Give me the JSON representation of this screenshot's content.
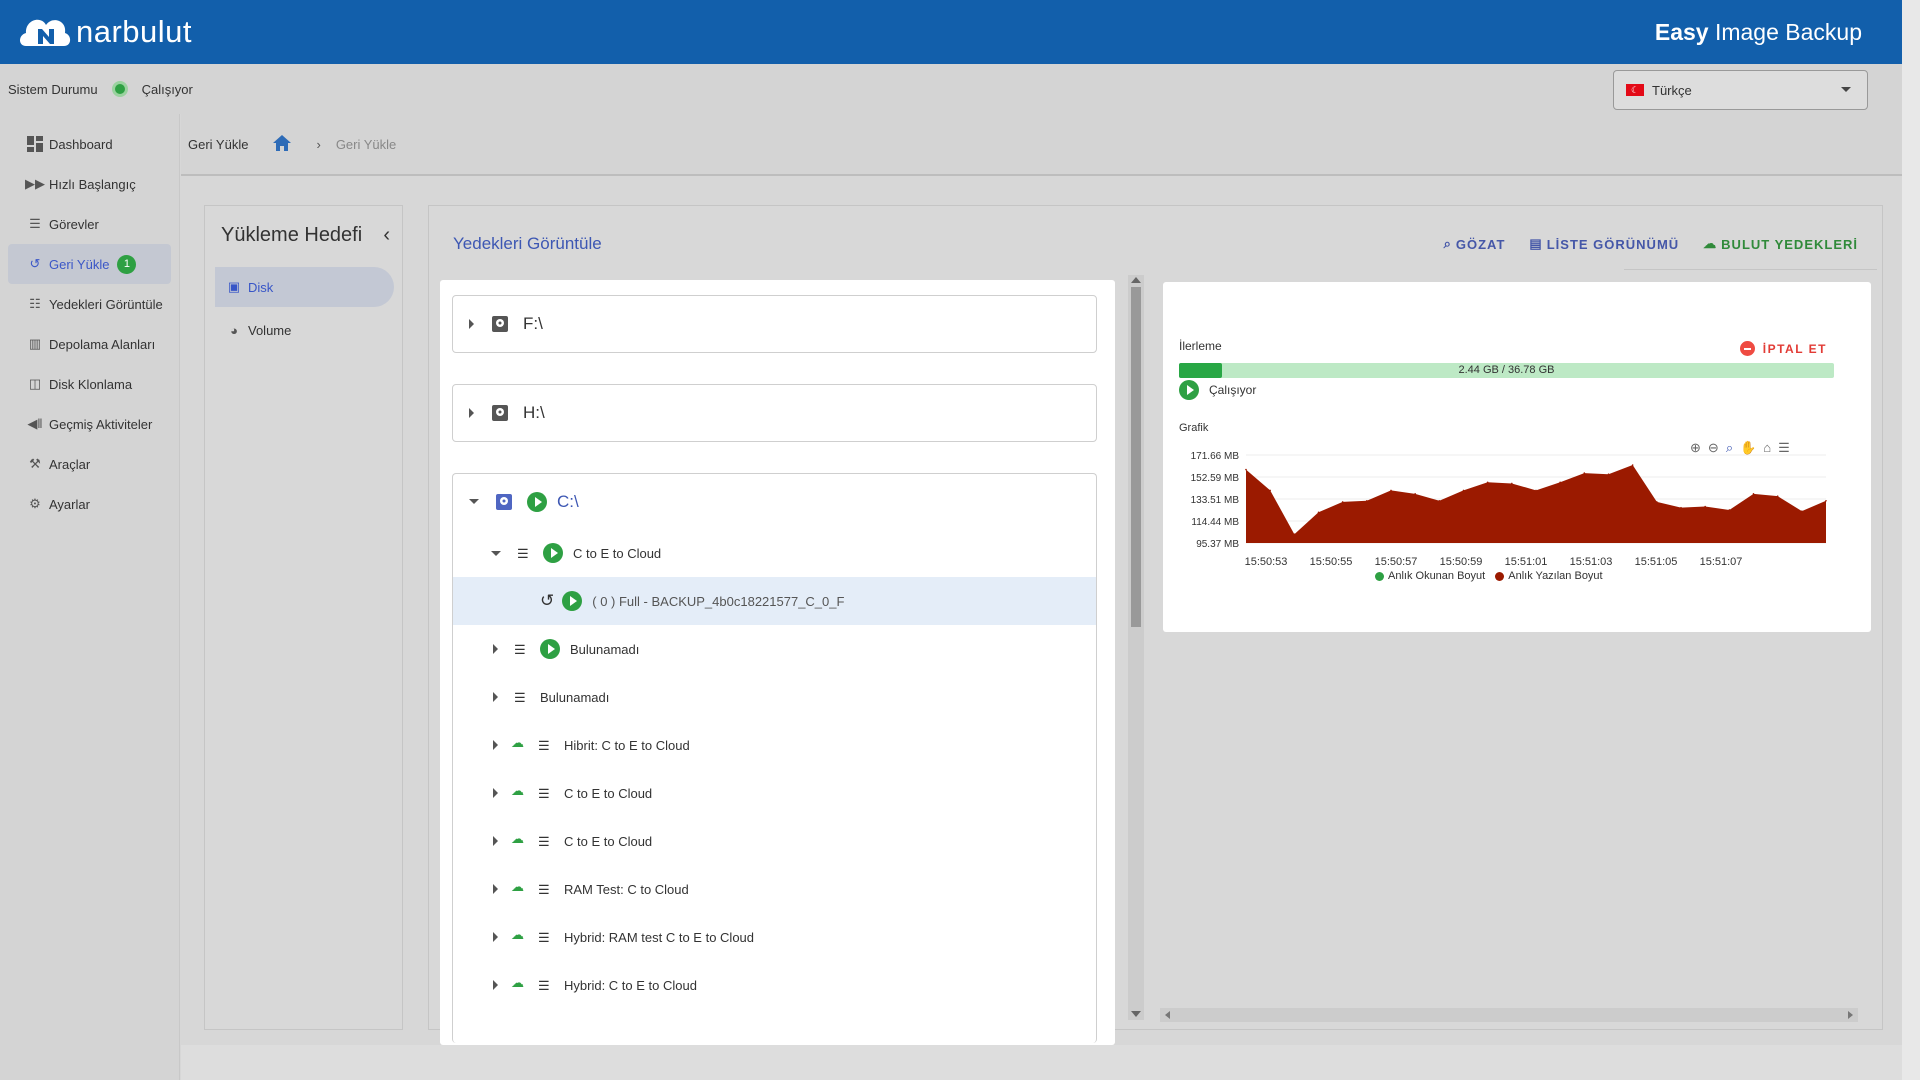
{
  "header": {
    "logo_text": "narbulut",
    "product_bold": "Easy",
    "product_rest": " Image Backup"
  },
  "status": {
    "label": "Sistem Durumu",
    "value": "Çalışıyor"
  },
  "language": {
    "selected": "Türkçe"
  },
  "sidebar": {
    "items": [
      {
        "label": "Dashboard",
        "icon": "dashboard-icon"
      },
      {
        "label": "Hızlı Başlangıç",
        "icon": "fast-forward-icon"
      },
      {
        "label": "Görevler",
        "icon": "list-icon"
      },
      {
        "label": "Geri Yükle",
        "icon": "restore-icon",
        "badge": "1"
      },
      {
        "label": "Yedekleri Görüntüle",
        "icon": "bullet-list-icon"
      },
      {
        "label": "Depolama Alanları",
        "icon": "storage-icon"
      },
      {
        "label": "Disk Klonlama",
        "icon": "disk-icon"
      },
      {
        "label": "Geçmiş Aktiviteler",
        "icon": "history-icon"
      },
      {
        "label": "Araçlar",
        "icon": "tools-icon"
      },
      {
        "label": "Ayarlar",
        "icon": "gear-icon"
      }
    ]
  },
  "breadcrumb": {
    "first": "Geri Yükle",
    "separator": "›",
    "last": "Geri Yükle"
  },
  "target": {
    "title": "Yükleme Hedefi",
    "items": [
      "Disk",
      "Volume"
    ]
  },
  "main": {
    "title": "Yedekleri Görüntüle",
    "actions": [
      "GÖZAT",
      "LİSTE GÖRÜNÜMÜ",
      "BULUT YEDEKLERİ"
    ]
  },
  "tree": {
    "drives": [
      "F:\\",
      "H:\\",
      "C:\\"
    ],
    "rows": [
      {
        "label": "C to E to Cloud"
      },
      {
        "label": "( 0 ) Full - BACKUP_4b0c18221577_C_0_F"
      },
      {
        "label": "Bulunamadı"
      },
      {
        "label": "Bulunamadı"
      },
      {
        "label": "Hibrit: C to E to Cloud"
      },
      {
        "label": "C to E to Cloud"
      },
      {
        "label": "C to E to Cloud"
      },
      {
        "label": "RAM Test: C to Cloud"
      },
      {
        "label": "Hybrid: RAM test C to E to Cloud"
      },
      {
        "label": "Hybrid: C to E to Cloud"
      }
    ]
  },
  "progress": {
    "label": "İlerleme",
    "cancel": "İPTAL ET",
    "text": "2.44 GB / 36.78 GB",
    "fraction": 0.066,
    "status": "Çalışıyor",
    "graph_label": "Grafik"
  },
  "colors": {
    "read": "#2ea043",
    "write": "#9b1a00",
    "accent": "#3d57b3"
  },
  "chart_data": {
    "type": "area",
    "y_ticks": [
      "171.66 MB",
      "152.59 MB",
      "133.51 MB",
      "114.44 MB",
      "95.37 MB"
    ],
    "x_ticks": [
      "15:50:53",
      "15:50:55",
      "15:50:57",
      "15:50:59",
      "15:51:01",
      "15:51:03",
      "15:51:05",
      "15:51:07"
    ],
    "ylim": [
      95.37,
      171.66
    ],
    "series": [
      {
        "name": "Anlık Okunan Boyut",
        "color": "#2ea043",
        "values": []
      },
      {
        "name": "Anlık Yazılan Boyut",
        "color": "#9b1a00",
        "values": [
          159,
          141,
          103,
          122,
          131,
          132,
          141,
          138,
          132,
          141,
          148,
          147,
          141,
          148,
          156,
          155,
          163,
          131,
          126,
          127,
          124,
          138,
          136,
          123,
          132
        ]
      }
    ]
  }
}
